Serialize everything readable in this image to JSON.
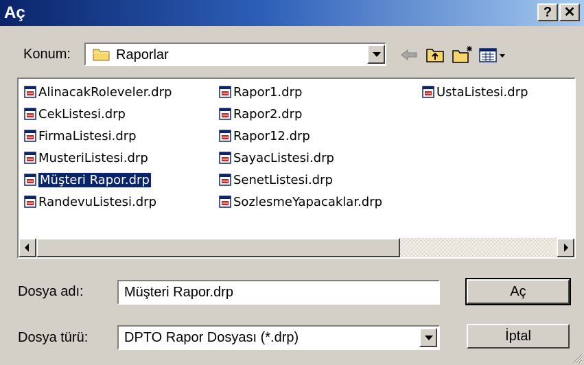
{
  "window": {
    "title": "Aç",
    "help_glyph": "?",
    "close_glyph": "✕"
  },
  "location": {
    "label": "Konum:",
    "value": "Raporlar"
  },
  "files": [
    {
      "name": "AlinacakRoleveler.drp",
      "selected": false
    },
    {
      "name": "CekListesi.drp",
      "selected": false
    },
    {
      "name": "FirmaListesi.drp",
      "selected": false
    },
    {
      "name": "MusteriListesi.drp",
      "selected": false
    },
    {
      "name": "Müşteri Rapor.drp",
      "selected": true
    },
    {
      "name": "RandevuListesi.drp",
      "selected": false
    },
    {
      "name": "Rapor1.drp",
      "selected": false
    },
    {
      "name": "Rapor2.drp",
      "selected": false
    },
    {
      "name": "Rapor12.drp",
      "selected": false
    },
    {
      "name": "SayacListesi.drp",
      "selected": false
    },
    {
      "name": "SenetListesi.drp",
      "selected": false
    },
    {
      "name": "SozlesmeYapacaklar.drp",
      "selected": false
    },
    {
      "name": "UstaListesi.drp",
      "selected": false
    }
  ],
  "filename": {
    "label": "Dosya adı:",
    "value": "Müşteri Rapor.drp"
  },
  "filetype": {
    "label": "Dosya türü:",
    "value": "DPTO Rapor Dosyası (*.drp)"
  },
  "buttons": {
    "open": "Aç",
    "cancel": "İptal"
  },
  "icons": [
    "folder-icon",
    "back-arrow-icon",
    "up-folder-icon",
    "new-folder-icon",
    "view-menu-icon",
    "file-icon"
  ],
  "colors": {
    "title_bar_start": "#0a246a",
    "title_bar_end": "#a6caf0",
    "selection": "#0a246a",
    "face": "#d4d0c8"
  }
}
